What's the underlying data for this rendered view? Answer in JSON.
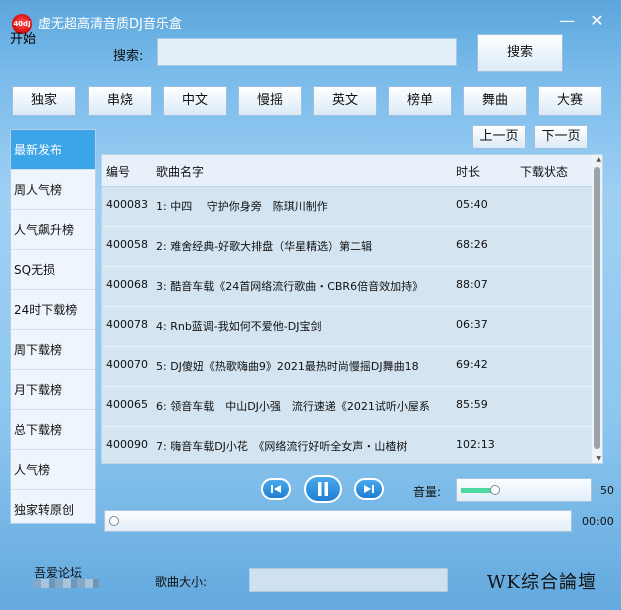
{
  "window": {
    "title": "虚无超高清音质DJ音乐盒",
    "logo_text": "40dJ",
    "start_label": "开始",
    "minimize_glyph": "—",
    "close_glyph": "✕"
  },
  "search": {
    "label": "搜索:",
    "value": "",
    "placeholder": "",
    "button_label": "搜索"
  },
  "categories": [
    "独家",
    "串烧",
    "中文",
    "慢摇",
    "英文",
    "榜单",
    "舞曲",
    "大赛"
  ],
  "pager": {
    "prev_label": "上一页",
    "next_label": "下一页"
  },
  "sidebar": {
    "items": [
      "最新发布",
      "周人气榜",
      "人气飙升榜",
      "SQ无损",
      "24时下载榜",
      "周下载榜",
      "月下载榜",
      "总下载榜",
      "人气榜",
      "独家转原创"
    ],
    "active": "最新发布"
  },
  "table": {
    "headers": {
      "id": "编号",
      "name": "歌曲名字",
      "duration": "时长",
      "status": "下载状态"
    },
    "rows": [
      {
        "id": "400083",
        "name": "1: 中四　 守护你身旁　陈琪川制作",
        "duration": "05:40"
      },
      {
        "id": "400058",
        "name": "2: 难舍经典-好歌大排盘（华星精选）第二辑",
        "duration": "68:26"
      },
      {
        "id": "400068",
        "name": "3: 酷音车载《24首网络流行歌曲・CBR6倍音效加持》",
        "duration": "88:07"
      },
      {
        "id": "400078",
        "name": "4: Rnb蓝调-我如何不爱他-DJ宝剑",
        "duration": "06:37"
      },
      {
        "id": "400070",
        "name": "5: DJ傻妞《热歌嗨曲9》2021最热时尚慢摇DJ舞曲18",
        "duration": "69:42"
      },
      {
        "id": "400065",
        "name": "6: 领音车载　中山DJ小强　流行速递《2021试听小屋系",
        "duration": "85:59"
      },
      {
        "id": "400090",
        "name": "7: 嗨音车载DJ小花　《网络流行好听全女声・山楂树",
        "duration": "102:13"
      }
    ]
  },
  "player": {
    "volume_label": "音量:",
    "volume": 50,
    "volume_text": "50",
    "progress": 0,
    "time": "00:00",
    "icons": [
      "skip-back-icon",
      "pause-icon",
      "skip-forward-icon"
    ]
  },
  "bottom": {
    "forum": "吾爱论坛",
    "size_label": "歌曲大小:",
    "size_value": "",
    "watermark": "WK综合論壇"
  },
  "colors": {
    "accent": "#3ba5e8",
    "volume_fill": "#4dd8a0"
  }
}
